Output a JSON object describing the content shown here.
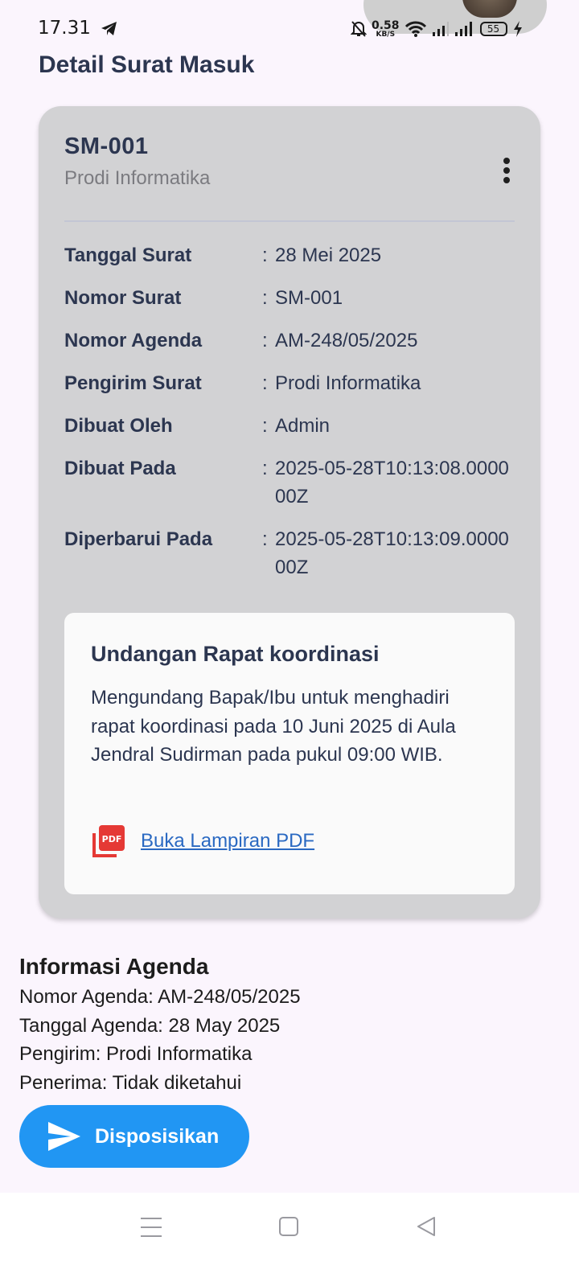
{
  "status_bar": {
    "time": "17.31",
    "net_speed": "0.58",
    "net_unit": "KB/S",
    "battery": "55"
  },
  "page": {
    "title": "Detail Surat Masuk"
  },
  "card": {
    "title": "SM-001",
    "subtitle": "Prodi Informatika",
    "details": [
      {
        "label": "Tanggal Surat",
        "colon": ":",
        "value": "28 Mei 2025"
      },
      {
        "label": "Nomor Surat",
        "colon": ":",
        "value": "SM-001"
      },
      {
        "label": "Nomor Agenda",
        "colon": ":",
        "value": "AM-248/05/2025"
      },
      {
        "label": "Pengirim Surat",
        "colon": ":",
        "value": "Prodi Informatika"
      },
      {
        "label": "Dibuat Oleh",
        "colon": ":",
        "value": "Admin"
      },
      {
        "label": "Dibuat Pada",
        "colon": ":",
        "value": "2025-05-28T10:13:08.000000Z"
      },
      {
        "label": "Diperbarui Pada",
        "colon": ":",
        "value": "2025-05-28T10:13:09.000000Z"
      }
    ],
    "letter": {
      "subject": "Undangan Rapat koordinasi",
      "body": "Mengundang Bapak/Ibu untuk menghadiri rapat koordinasi pada 10 Juni 2025 di Aula Jendral Sudirman pada pukul 09:00 WIB.",
      "pdf_icon_text": "PDF",
      "pdf_link": "Buka Lampiran PDF"
    }
  },
  "agenda": {
    "title": "Informasi Agenda",
    "lines": [
      "Nomor Agenda: AM-248/05/2025",
      "Tanggal Agenda: 28 May 2025",
      "Pengirim: Prodi Informatika",
      "Penerima: Tidak diketahui"
    ]
  },
  "actions": {
    "dispose_label": "Disposisikan"
  },
  "colors": {
    "background": "#fbf5fd",
    "card": "#d2d2d4",
    "primary": "#2196f3",
    "link": "#2a69c2",
    "pdf_red": "#e53935"
  }
}
